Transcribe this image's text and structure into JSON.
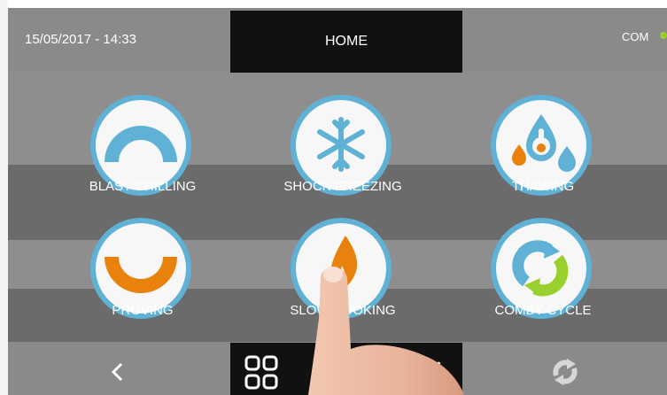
{
  "status_bar": {
    "datetime": "15/05/2017 - 14:33",
    "title": "HOME",
    "com_label": "COM",
    "com_status_color": "#9ad02e"
  },
  "programs": [
    {
      "label": "BLAST CHILLING",
      "icon": "blast-chilling-arc-icon",
      "color": "#5fb1d6"
    },
    {
      "label": "SHOCK FREEZING",
      "icon": "snowflake-icon",
      "color": "#5fb1d6"
    },
    {
      "label": "THAWING",
      "icon": "thermometer-drops-icon",
      "color": "#5fb1d6"
    },
    {
      "label": "PROVING",
      "icon": "proving-arc-icon",
      "color": "#e8820c"
    },
    {
      "label": "SLOW COOKING",
      "icon": "flame-icon",
      "color": "#e8820c"
    },
    {
      "label": "COMBY CYCLE",
      "icon": "cycle-icon",
      "color": "#9ad02e"
    }
  ],
  "bottom_nav": {
    "back": "chevron-left-icon",
    "menu": "grid-icon",
    "edit": "pen-icon",
    "refresh": "refresh-icon"
  },
  "colors": {
    "accent_blue": "#5fb1d6",
    "accent_orange": "#e8820c",
    "accent_green": "#9ad02e"
  }
}
